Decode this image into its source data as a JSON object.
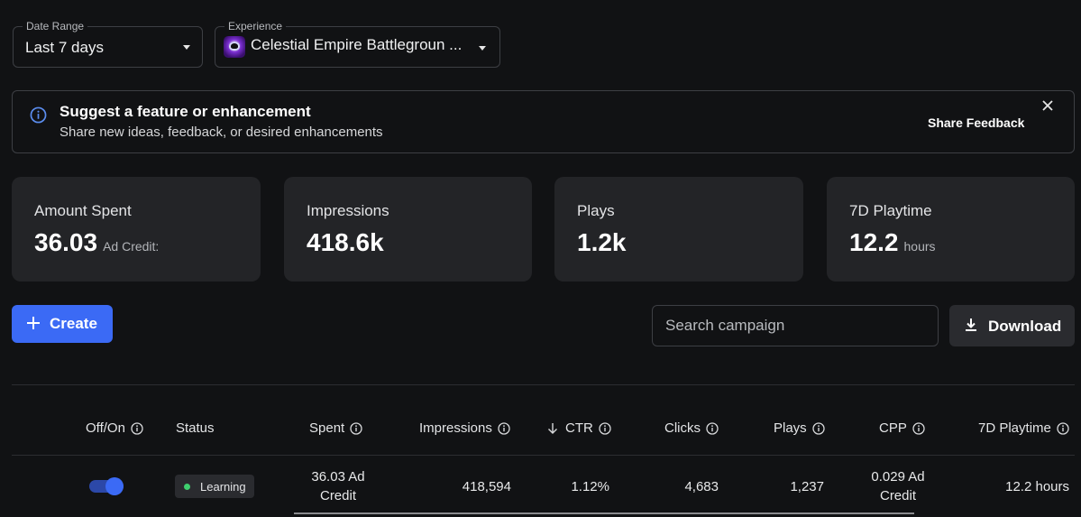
{
  "filters": {
    "date_range": {
      "legend": "Date Range",
      "value": "Last 7 days"
    },
    "experience": {
      "legend": "Experience",
      "value": "Celestial Empire Battlegroun ..."
    }
  },
  "banner": {
    "title": "Suggest a feature or enhancement",
    "subtitle": "Share new ideas, feedback, or desired enhancements",
    "action_label": "Share Feedback"
  },
  "stats": [
    {
      "label": "Amount Spent",
      "value": "36.03",
      "unit": "Ad Credit:"
    },
    {
      "label": "Impressions",
      "value": "418.6k",
      "unit": ""
    },
    {
      "label": "Plays",
      "value": "1.2k",
      "unit": ""
    },
    {
      "label": "7D Playtime",
      "value": "12.2",
      "unit": "hours"
    }
  ],
  "actions": {
    "create_label": "Create",
    "search_placeholder": "Search campaign",
    "download_label": "Download"
  },
  "table": {
    "headers": {
      "off_on": "Off/On",
      "status": "Status",
      "spent": "Spent",
      "impressions": "Impressions",
      "ctr": "CTR",
      "clicks": "Clicks",
      "plays": "Plays",
      "cpp": "CPP",
      "playtime": "7D Playtime"
    },
    "rows": [
      {
        "toggle_on": true,
        "status": "Learning",
        "spent_line1": "36.03 Ad",
        "spent_line2": "Credit",
        "impressions": "418,594",
        "ctr": "1.12%",
        "clicks": "4,683",
        "plays": "1,237",
        "cpp_line1": "0.029 Ad",
        "cpp_line2": "Credit",
        "playtime": "12.2 hours"
      }
    ]
  },
  "colors": {
    "background": "#111214",
    "card": "#232427",
    "accent": "#3b6af5",
    "status_learning": "#3ecf6e",
    "info_icon": "#5b8def"
  }
}
